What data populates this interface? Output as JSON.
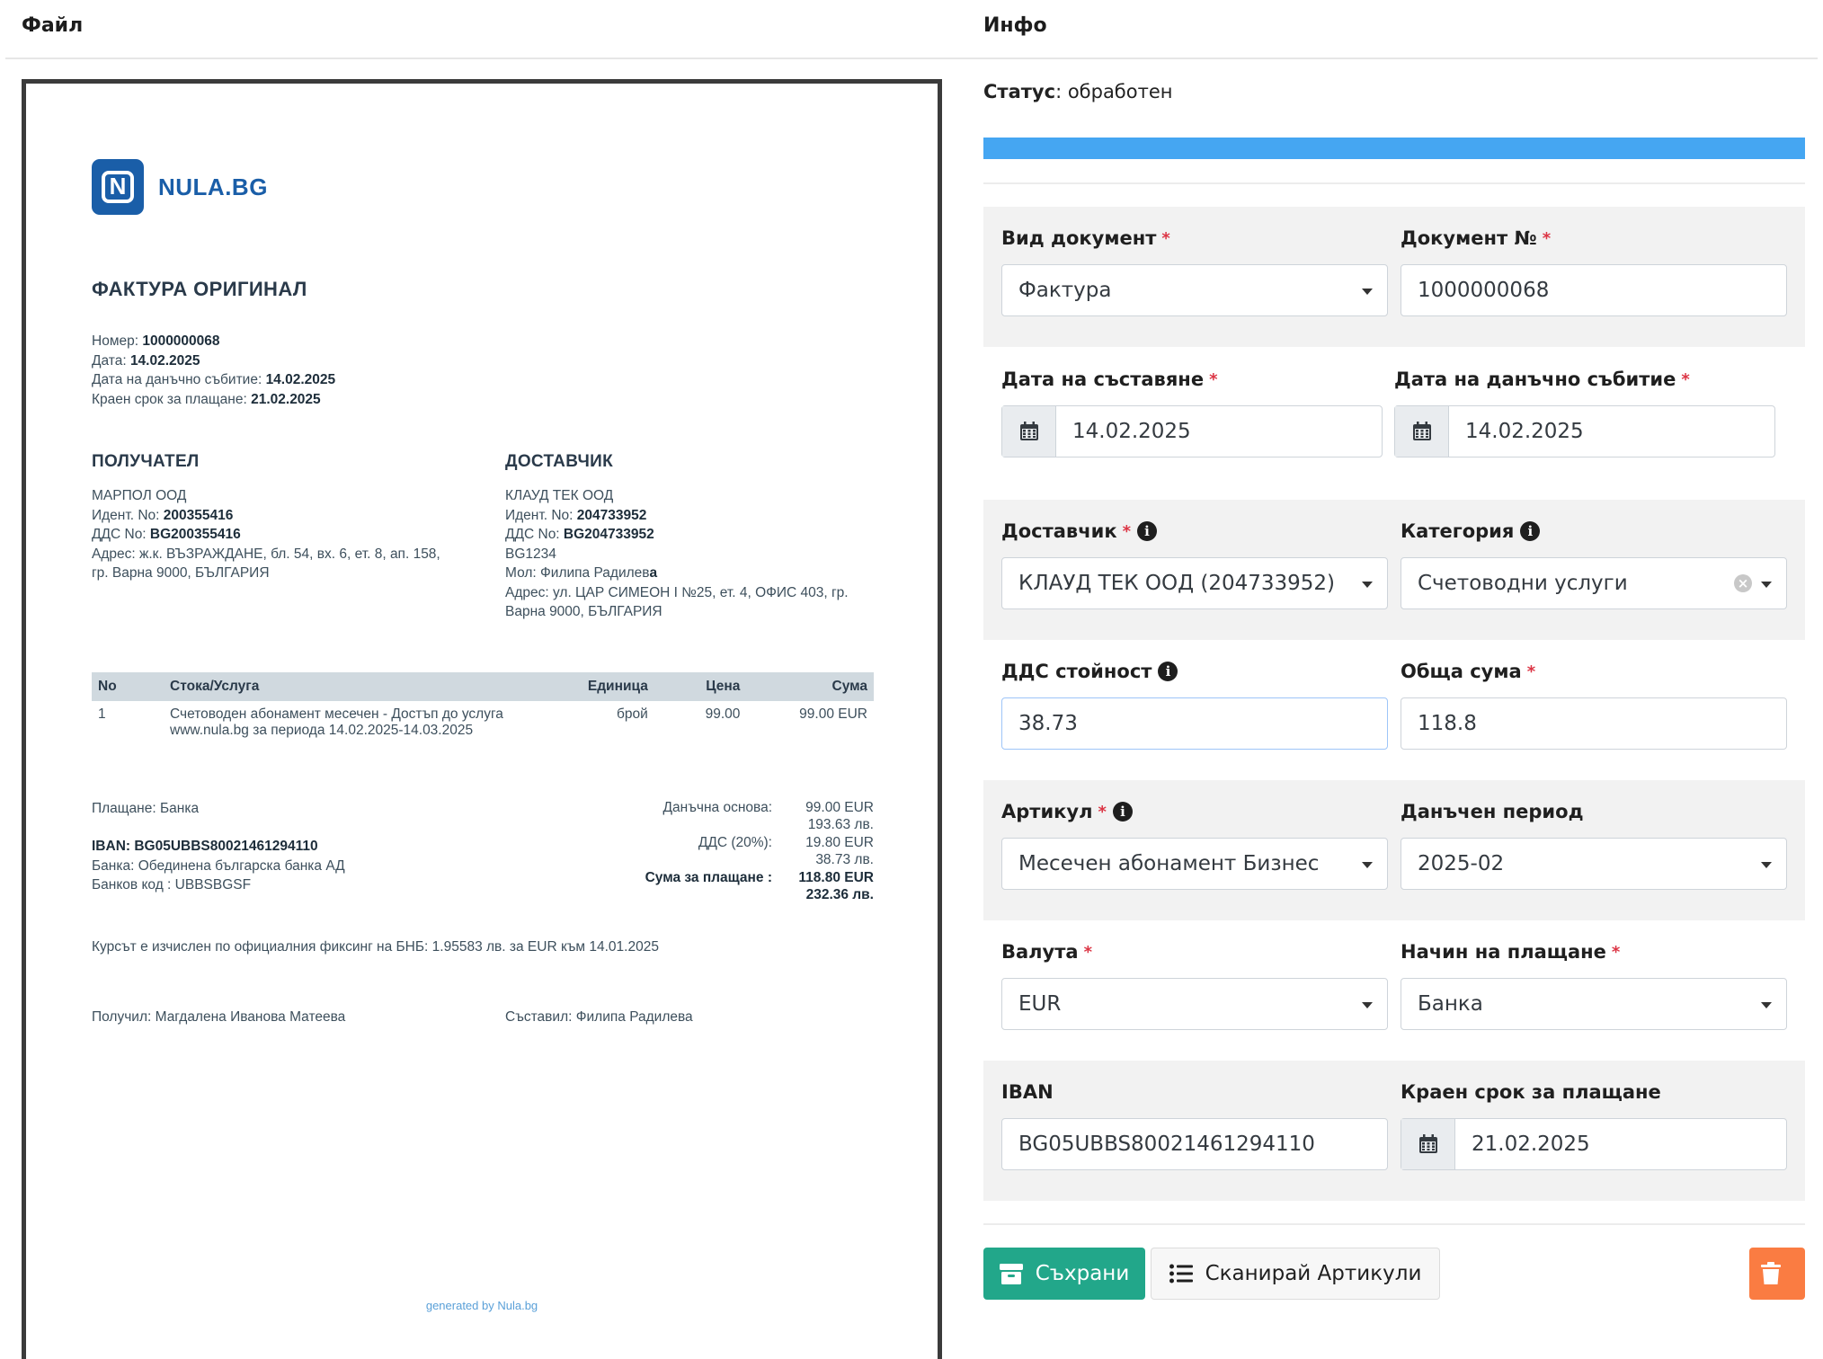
{
  "headers": {
    "file": "Файл",
    "info": "Инфо"
  },
  "invoice": {
    "brand": "NULA.BG",
    "logo_letter": "N",
    "title": "ФАКТУРА ОРИГИНАЛ",
    "meta": [
      {
        "label": "Номер: ",
        "value": "1000000068"
      },
      {
        "label": "Дата: ",
        "value": "14.02.2025"
      },
      {
        "label": "Дата на данъчно събитие: ",
        "value": "14.02.2025"
      },
      {
        "label": "Краен срок за плащане: ",
        "value": "21.02.2025"
      }
    ],
    "recipient": {
      "title": "ПОЛУЧАТЕЛ",
      "name": "МАРПОЛ ООД",
      "id_label": "Идент. No: ",
      "id": "200355416",
      "vat_label": "ДДС No: ",
      "vat": "BG200355416",
      "address1": "Адрес: ж.к. ВЪЗРАЖДАНЕ, бл. 54, вх. 6, ет. 8, ап. 158,",
      "address2": "гр. Варна 9000, БЪЛГАРИЯ"
    },
    "supplier": {
      "title": "ДОСТАВЧИК",
      "name": "КЛАУД ТЕК ООД",
      "id_label": "Идент. No: ",
      "id": "204733952",
      "vat_label": "ДДС No: ",
      "vat": "BG204733952",
      "extra": "BG1234",
      "mol_label": "Мол: Филипа Радилев",
      "mol_bold": "а",
      "address1": "Адрес: ул. ЦАР СИМЕОН I №25, ет. 4, ОФИС 403, гр.",
      "address2": "Варна 9000, БЪЛГАРИЯ"
    },
    "table": {
      "headers": {
        "no": "No",
        "item": "Стока/Услуга",
        "unit": "Единица",
        "price": "Цена",
        "sum": "Сума"
      },
      "rows": [
        {
          "no": "1",
          "item1": "Счетоводен абонамент месечен - Достъп до услуга",
          "item2": "www.nula.bg за периода 14.02.2025-14.03.2025",
          "unit": "брой",
          "price": "99.00",
          "sum": "99.00 EUR"
        }
      ]
    },
    "payment": {
      "method": "Плащане: Банка",
      "iban": "IBAN: BG05UBBS80021461294110",
      "bank": "Банка: Обединена българска банка АД",
      "bank_code": "Банков код : UBBSBGSF"
    },
    "totals": {
      "base_label": "Данъчна основа:",
      "base_eur": "99.00 EUR",
      "base_bgn": "193.63 лв.",
      "vat_label": "ДДС (20%):",
      "vat_eur": "19.80 EUR",
      "vat_bgn": "38.73 лв.",
      "total_label": "Сума за плащане :",
      "total_eur": "118.80 EUR",
      "total_bgn": "232.36 лв."
    },
    "rate_note": "Курсът е изчислен по официалния фиксинг на БНБ: 1.95583 лв. за EUR към 14.01.2025",
    "received": "Получил: Магдалена Иванова Матеева",
    "composed": "Съставил: Филипа Радилева",
    "generated": "generated by Nula.bg"
  },
  "info": {
    "status_label": "Статус",
    "status_value": ": обработен",
    "progress": 1.0,
    "doc_type": {
      "label": "Вид документ",
      "value": "Фактура"
    },
    "doc_no": {
      "label": "Документ №",
      "value": "1000000068"
    },
    "issue_date": {
      "label": "Дата на съставяне",
      "value": "14.02.2025"
    },
    "tax_date": {
      "label": "Дата на данъчно събитие",
      "value": "14.02.2025"
    },
    "supplier": {
      "label": "Доставчик",
      "value": "КЛАУД ТЕК ООД (204733952)"
    },
    "category": {
      "label": "Категория",
      "value": "Счетоводни услуги"
    },
    "vat": {
      "label": "ДДС стойност",
      "value": "38.73"
    },
    "total": {
      "label": "Обща сума",
      "value": "118.8"
    },
    "article": {
      "label": "Артикул",
      "value": "Месечен абонамент Бизнес"
    },
    "tax_period": {
      "label": "Данъчен период",
      "value": "2025-02"
    },
    "currency": {
      "label": "Валута",
      "value": "EUR"
    },
    "payment_method": {
      "label": "Начин на плащане",
      "value": "Банка"
    },
    "iban": {
      "label": "IBAN",
      "value": "BG05UBBS80021461294110"
    },
    "due_date": {
      "label": "Краен срок за плащане",
      "value": "21.02.2025"
    },
    "required_mark": "*",
    "info_mark": "i",
    "clear_mark": "×"
  },
  "actions": {
    "save": "Съхрани",
    "scan": "Сканирай Артикули"
  },
  "colors": {
    "accent": "#45a6f2",
    "save": "#22a78a",
    "delete": "#fa7c42",
    "brand": "#1a5ea8"
  }
}
